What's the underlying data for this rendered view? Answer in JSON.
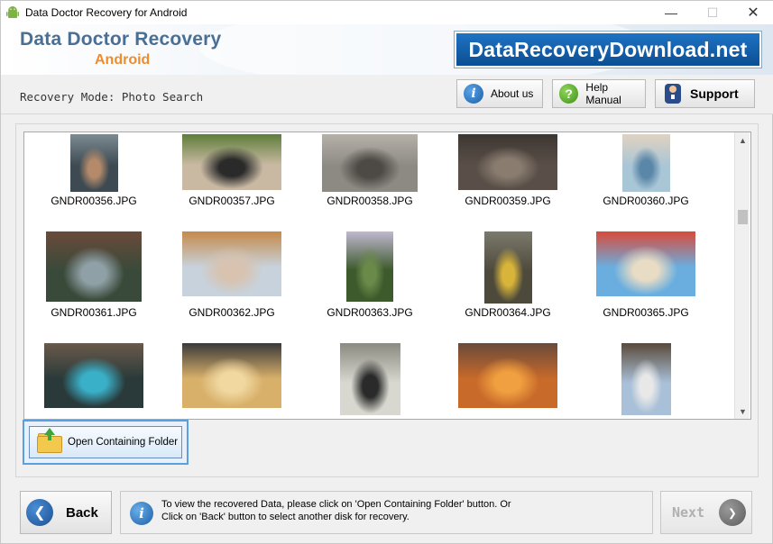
{
  "window": {
    "title": "Data Doctor Recovery for Android",
    "controls": {
      "minimize": "—",
      "maximize": "☐",
      "close": "✕"
    }
  },
  "header": {
    "brand_title": "Data Doctor Recovery",
    "brand_subtitle": "Android",
    "site_banner": "DataRecoveryDownload.net",
    "colors": {
      "brand_title": "#4a6f95",
      "brand_subtitle": "#f08c2a",
      "banner_bg": "#0b4f93"
    }
  },
  "mode_row": {
    "label": "Recovery Mode: Photo Search",
    "about_label": "About us",
    "help_label": "Help Manual",
    "support_label": "Support",
    "about_icon": "info-icon",
    "help_icon": "question-icon",
    "support_icon": "support-person-icon"
  },
  "gallery": {
    "items": [
      {
        "name": "GNDR00356.JPG",
        "colors": [
          "#3d4a52",
          "#b48a6a",
          "#7c8a92"
        ]
      },
      {
        "name": "GNDR00357.JPG",
        "colors": [
          "#c9b9a3",
          "#2a2a2a",
          "#5d7d3a"
        ]
      },
      {
        "name": "GNDR00358.JPG",
        "colors": [
          "#8d8a84",
          "#4d4a45",
          "#b5b0a8"
        ]
      },
      {
        "name": "GNDR00359.JPG",
        "colors": [
          "#5a4f48",
          "#8a7d70",
          "#3c3632"
        ]
      },
      {
        "name": "GNDR00360.JPG",
        "colors": [
          "#a9c6d6",
          "#5a86a8",
          "#e0d2c0"
        ]
      },
      {
        "name": "GNDR00361.JPG",
        "colors": [
          "#3a4a3a",
          "#8fa0a6",
          "#6a4a3a"
        ]
      },
      {
        "name": "GNDR00362.JPG",
        "colors": [
          "#c8d2dc",
          "#d7c3b0",
          "#c58a4a"
        ]
      },
      {
        "name": "GNDR00363.JPG",
        "colors": [
          "#3d5a2c",
          "#6a8a4a",
          "#c0b8d0"
        ]
      },
      {
        "name": "GNDR00364.JPG",
        "colors": [
          "#4d4a3c",
          "#d8b43a",
          "#7c7a6c"
        ]
      },
      {
        "name": "GNDR00365.JPG",
        "colors": [
          "#6aaee0",
          "#e8dcc4",
          "#d84a3a"
        ]
      },
      {
        "name": "",
        "colors": [
          "#2a3a3a",
          "#3ab0c8",
          "#6a5a4a"
        ]
      },
      {
        "name": "",
        "colors": [
          "#d8b06a",
          "#f0d8a0",
          "#3a3a3a"
        ]
      },
      {
        "name": "",
        "colors": [
          "#d8d8d0",
          "#2a2a2a",
          "#8a8a80"
        ]
      },
      {
        "name": "",
        "colors": [
          "#c86a2a",
          "#f0a040",
          "#6a4a3a"
        ]
      },
      {
        "name": "",
        "colors": [
          "#a8c0d8",
          "#e8e8e8",
          "#5a4a3a"
        ]
      }
    ]
  },
  "open_folder": {
    "label": "Open Containing Folder",
    "icon": "folder-up-icon"
  },
  "bottom": {
    "back_label": "Back",
    "next_label": "Next",
    "info_line1": "To view the recovered Data, please click on 'Open Containing Folder' button. Or",
    "info_line2": "Click on 'Back' button to select another disk for recovery.",
    "back_icon": "arrow-left-icon",
    "next_icon": "arrow-right-icon",
    "info_icon": "info-icon"
  }
}
